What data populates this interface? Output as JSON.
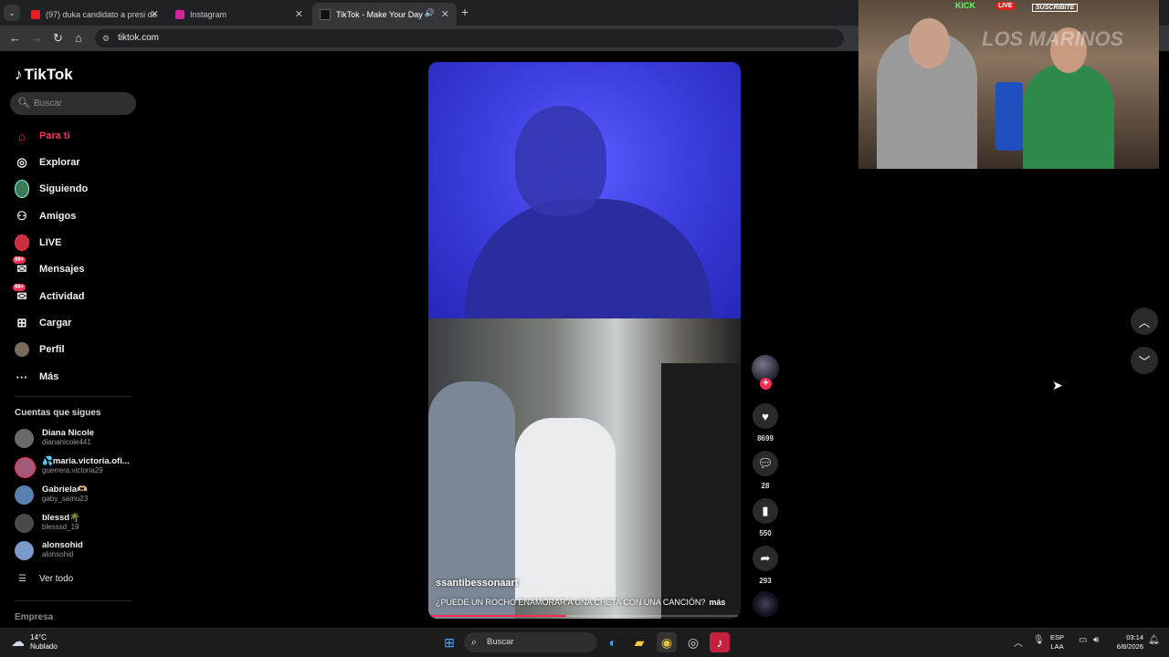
{
  "browser": {
    "tabs": [
      {
        "title": "(97) duka candidato a presi de",
        "favicon_color": "#e02020"
      },
      {
        "title": "Instagram",
        "favicon_color": "#d6249f"
      },
      {
        "title": "TikTok - Make Your Day",
        "favicon_color": "#111111"
      }
    ],
    "new_tab_glyph": "+",
    "url": "tiktok.com"
  },
  "sidebar": {
    "logo_text": "TikTok",
    "search_placeholder": "Buscar",
    "menu": [
      {
        "label": "Para ti",
        "icon": "home-icon",
        "glyph": "⌂"
      },
      {
        "label": "Explorar",
        "icon": "compass-icon",
        "glyph": "◎"
      },
      {
        "label": "Siguiendo",
        "icon": "following-avatar-icon",
        "glyph": "●"
      },
      {
        "label": "Amigos",
        "icon": "friends-icon",
        "glyph": "👥"
      },
      {
        "label": "LIVE",
        "icon": "live-icon",
        "glyph": "●"
      },
      {
        "label": "Mensajes",
        "icon": "messages-icon",
        "glyph": "✉",
        "badge": "99+"
      },
      {
        "label": "Actividad",
        "icon": "activity-icon",
        "glyph": "✉",
        "badge": "99+"
      },
      {
        "label": "Cargar",
        "icon": "upload-icon",
        "glyph": "⊞"
      },
      {
        "label": "Perfil",
        "icon": "profile-avatar-icon",
        "glyph": "●"
      },
      {
        "label": "Más",
        "icon": "more-icon",
        "glyph": "···"
      }
    ],
    "following_title": "Cuentas que sigues",
    "accounts": [
      {
        "name": "Diana Nicole",
        "handle": "diananicole441",
        "color": "#6a6a6a"
      },
      {
        "name": "💦maria.victoria.ofi...",
        "handle": "guerrera.victoria29",
        "color": "#a05a7a"
      },
      {
        "name": "Gabriela🫶🏼",
        "handle": "gaby_samu23",
        "color": "#5a80b0"
      },
      {
        "name": "blessd🌴",
        "handle": "blesssd_19",
        "color": "#4a4a4a"
      },
      {
        "name": "alonsohid",
        "handle": "alonsohid",
        "color": "#7a9ac8"
      }
    ],
    "see_all": "Ver todo",
    "company": "Empresa"
  },
  "video": {
    "creator": "ssantibessonaart",
    "caption": "¿PUEDE UN ROCHO ENAMORAR A UNA CHETA CON UNA CANCIÓN?",
    "more": "más",
    "progress": 0.44
  },
  "actions": {
    "likes": "8699",
    "comments": "28",
    "saves": "550",
    "shares": "293"
  },
  "stream_overlay": {
    "kick": "KICK",
    "live": "LIVE",
    "subscribe": "SUSCRIBITE",
    "brand": "LOS MARINOS"
  },
  "taskbar": {
    "weather_temp": "14°C",
    "weather_desc": "Nublado",
    "search_placeholder": "Buscar",
    "lang_line1": "ESP",
    "lang_line2": "LAA",
    "time": "03:14",
    "date": "6/8/2026"
  },
  "colors": {
    "accent": "#fe2c55",
    "chrome_bg": "#202124",
    "sidebar_bg": "#000000"
  }
}
